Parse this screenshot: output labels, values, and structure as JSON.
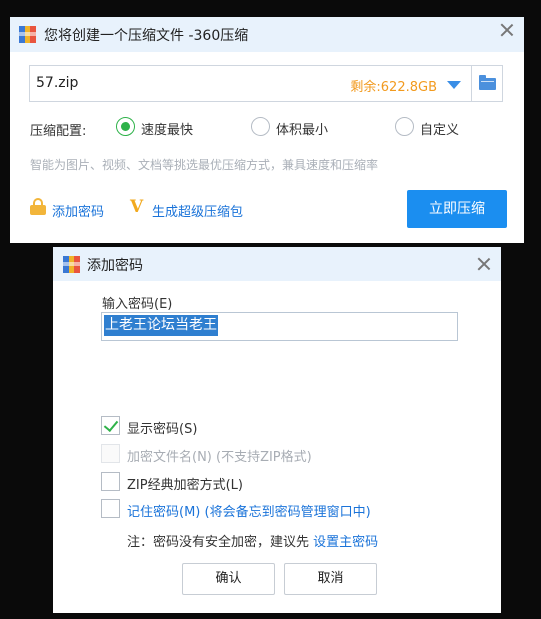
{
  "main_window": {
    "title": "您将创建一个压缩文件 -360压缩",
    "path": {
      "value": "57.zip",
      "free_space": "剩余:622.8GB"
    },
    "config_label": "压缩配置:",
    "options": [
      {
        "label": "速度最快",
        "checked": true
      },
      {
        "label": "体积最小",
        "checked": false
      },
      {
        "label": "自定义",
        "checked": false
      }
    ],
    "hint": "智能为图片、视频、文档等挑选最优压缩方式，兼具速度和压缩率",
    "add_password_link": "添加密码",
    "super_compress_link": "生成超级压缩包",
    "compress_button": "立即压缩"
  },
  "password_dialog": {
    "title": "添加密码",
    "input_label": "输入密码(E)",
    "password_value": "上老王论坛当老王",
    "checkboxes": [
      {
        "label": "显示密码(S)",
        "checked": true,
        "disabled": false
      },
      {
        "label": "加密文件名(N) (不支持ZIP格式)",
        "checked": false,
        "disabled": true
      },
      {
        "label": "ZIP经典加密方式(L)",
        "checked": false,
        "disabled": false
      },
      {
        "label": "记住密码(M) (将会备忘到密码管理窗口中)",
        "checked": false,
        "disabled": false
      }
    ],
    "note_text": "注：密码没有安全加密，建议先 ",
    "note_link": "设置主密码",
    "ok_button": "确认",
    "cancel_button": "取消"
  },
  "colors": {
    "accent_blue": "#1b8ef0",
    "link_blue": "#1a73d9",
    "check_green": "#2fb24a",
    "free_space_orange": "#f29a1e"
  }
}
